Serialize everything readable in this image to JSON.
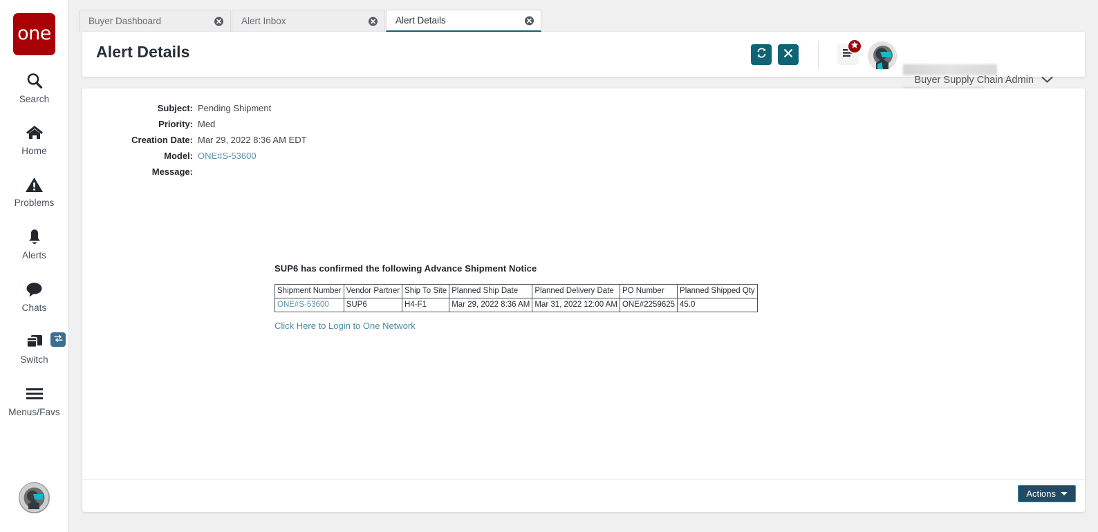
{
  "brand": {
    "logo_text": "one",
    "logo_color": "#a90005"
  },
  "theme": {
    "accent": "#0e6374",
    "link": "#5692aa",
    "actions_bg": "#224a63",
    "badge_red": "#9e0606"
  },
  "sidebar": {
    "items": [
      {
        "label": "Search",
        "icon": "search-icon"
      },
      {
        "label": "Home",
        "icon": "home-icon"
      },
      {
        "label": "Problems",
        "icon": "warning-triangle-icon"
      },
      {
        "label": "Alerts",
        "icon": "bell-icon"
      },
      {
        "label": "Chats",
        "icon": "chat-bubble-icon"
      },
      {
        "label": "Switch",
        "icon": "switch-windows-icon"
      },
      {
        "label": "Menus/Favs",
        "icon": "hamburger-icon"
      }
    ],
    "switch_badge_icon": "exchange-arrows-icon",
    "bottom_avatar_icon": "user-avatar"
  },
  "tabs": [
    {
      "label": "Buyer Dashboard",
      "active": false
    },
    {
      "label": "Alert Inbox",
      "active": false
    },
    {
      "label": "Alert Details",
      "active": true
    }
  ],
  "header": {
    "title": "Alert Details",
    "refresh_icon": "refresh-icon",
    "close_icon": "close-x-icon",
    "menu_icon": "hamburger-menu-icon",
    "menu_badge_icon": "star-icon",
    "avatar_icon": "user-avatar",
    "user_role": "Buyer Supply Chain Admin",
    "dropdown_icon": "chevron-down-icon"
  },
  "details": {
    "fields": [
      {
        "label": "Subject:",
        "value": "Pending Shipment",
        "link": false
      },
      {
        "label": "Priority:",
        "value": "Med",
        "link": false
      },
      {
        "label": "Creation Date:",
        "value": "Mar 29, 2022 8:36 AM EDT",
        "link": false
      },
      {
        "label": "Model:",
        "value": "ONE#S-53600",
        "link": true
      }
    ],
    "message_label": "Message:",
    "message_headline": "SUP6 has confirmed the following Advance Shipment Notice",
    "login_link": "Click Here to Login to One Network"
  },
  "asn_table": {
    "headers": [
      "Shipment Number",
      "Vendor Partner",
      "Ship To Site",
      "Planned Ship Date",
      "Planned Delivery Date",
      "PO Number",
      "Planned Shipped Qty"
    ],
    "rows": [
      {
        "cells": [
          "ONE#S-53600",
          "SUP6",
          "H4-F1",
          "Mar 29, 2022 8:36 AM",
          "Mar 31, 2022 12:00 AM",
          "ONE#2259625",
          "45.0"
        ],
        "link_columns": [
          0
        ]
      }
    ]
  },
  "footer": {
    "actions_label": "Actions"
  }
}
